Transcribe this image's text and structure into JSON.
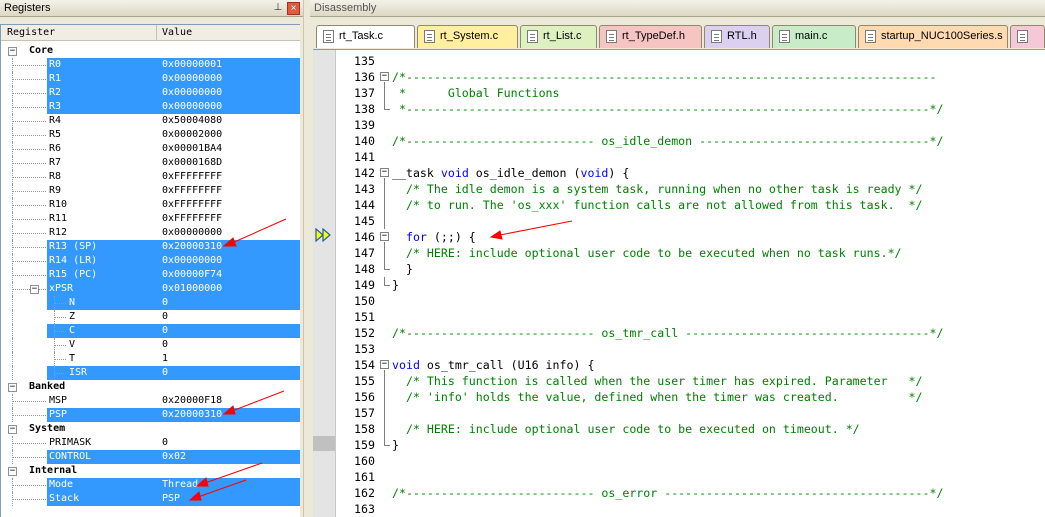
{
  "registers_panel": {
    "title": "Registers",
    "pin_glyph": "⊥",
    "close_glyph": "×",
    "header_register": "Register",
    "header_value": "Value",
    "rows": [
      {
        "name": "Core",
        "value": "",
        "level": 0,
        "group": true,
        "sel": false
      },
      {
        "name": "R0",
        "value": "0x00000001",
        "level": 1,
        "sel": true
      },
      {
        "name": "R1",
        "value": "0x00000000",
        "level": 1,
        "sel": true
      },
      {
        "name": "R2",
        "value": "0x00000000",
        "level": 1,
        "sel": true
      },
      {
        "name": "R3",
        "value": "0x00000000",
        "level": 1,
        "sel": true
      },
      {
        "name": "R4",
        "value": "0x50004080",
        "level": 1,
        "sel": false
      },
      {
        "name": "R5",
        "value": "0x00002000",
        "level": 1,
        "sel": false
      },
      {
        "name": "R6",
        "value": "0x00001BA4",
        "level": 1,
        "sel": false
      },
      {
        "name": "R7",
        "value": "0x0000168D",
        "level": 1,
        "sel": false
      },
      {
        "name": "R8",
        "value": "0xFFFFFFFF",
        "level": 1,
        "sel": false
      },
      {
        "name": "R9",
        "value": "0xFFFFFFFF",
        "level": 1,
        "sel": false
      },
      {
        "name": "R10",
        "value": "0xFFFFFFFF",
        "level": 1,
        "sel": false
      },
      {
        "name": "R11",
        "value": "0xFFFFFFFF",
        "level": 1,
        "sel": false
      },
      {
        "name": "R12",
        "value": "0x00000000",
        "level": 1,
        "sel": false
      },
      {
        "name": "R13 (SP)",
        "value": "0x20000310",
        "level": 1,
        "sel": true
      },
      {
        "name": "R14 (LR)",
        "value": "0x00000000",
        "level": 1,
        "sel": true
      },
      {
        "name": "R15 (PC)",
        "value": "0x00000F74",
        "level": 1,
        "sel": true
      },
      {
        "name": "xPSR",
        "value": "0x01000000",
        "level": 1,
        "sel": true,
        "expandable": true
      },
      {
        "name": "N",
        "value": "0",
        "level": 2,
        "sel": true
      },
      {
        "name": "Z",
        "value": "0",
        "level": 2,
        "sel": false
      },
      {
        "name": "C",
        "value": "0",
        "level": 2,
        "sel": true
      },
      {
        "name": "V",
        "value": "0",
        "level": 2,
        "sel": false
      },
      {
        "name": "T",
        "value": "1",
        "level": 2,
        "sel": false
      },
      {
        "name": "ISR",
        "value": "0",
        "level": 2,
        "sel": true
      },
      {
        "name": "Banked",
        "value": "",
        "level": 0,
        "group": true,
        "sel": false
      },
      {
        "name": "MSP",
        "value": "0x20000F18",
        "level": 1,
        "sel": false
      },
      {
        "name": "PSP",
        "value": "0x20000310",
        "level": 1,
        "sel": true
      },
      {
        "name": "System",
        "value": "",
        "level": 0,
        "group": true,
        "sel": false
      },
      {
        "name": "PRIMASK",
        "value": "0",
        "level": 1,
        "sel": false
      },
      {
        "name": "CONTROL",
        "value": "0x02",
        "level": 1,
        "sel": true
      },
      {
        "name": "Internal",
        "value": "",
        "level": 0,
        "group": true,
        "sel": false
      },
      {
        "name": "Mode",
        "value": "Thread",
        "level": 1,
        "sel": true
      },
      {
        "name": "Stack",
        "value": "PSP",
        "level": 1,
        "sel": true
      }
    ]
  },
  "disassembly_panel": {
    "title": "Disassembly",
    "tabs": [
      {
        "label": "rt_Task.c",
        "color": "#ffffff"
      },
      {
        "label": "rt_System.c",
        "color": "#ffef9e"
      },
      {
        "label": "rt_List.c",
        "color": "#ddf0c0"
      },
      {
        "label": "rt_TypeDef.h",
        "color": "#f7c4c4"
      },
      {
        "label": "RTL.h",
        "color": "#dcd0f0"
      },
      {
        "label": "main.c",
        "color": "#c8ecc8"
      },
      {
        "label": "startup_NUC100Series.s",
        "color": "#ffd9b0"
      },
      {
        "label": "",
        "color": "#f5c8d8"
      }
    ],
    "lines": [
      {
        "n": "135",
        "t": [],
        "fold": ""
      },
      {
        "n": "136",
        "t": [
          [
            "c-com",
            "/*----------------------------------------------------------------------------"
          ]
        ],
        "fold": "open"
      },
      {
        "n": "137",
        "t": [
          [
            "c-com",
            " *      Global Functions"
          ]
        ],
        "fold": "mid"
      },
      {
        "n": "138",
        "t": [
          [
            "c-com",
            " *---------------------------------------------------------------------------*/"
          ]
        ],
        "fold": "end"
      },
      {
        "n": "139",
        "t": [],
        "fold": ""
      },
      {
        "n": "140",
        "t": [
          [
            "c-com",
            "/*--------------------------- os_idle_demon ---------------------------------*/"
          ]
        ],
        "fold": ""
      },
      {
        "n": "141",
        "t": [],
        "fold": ""
      },
      {
        "n": "142",
        "t": [
          [
            "c-txt",
            "__task "
          ],
          [
            "c-kw",
            "void"
          ],
          [
            "c-txt",
            " os_idle_demon ("
          ],
          [
            "c-kw",
            "void"
          ],
          [
            "c-txt",
            ") {"
          ]
        ],
        "fold": "open"
      },
      {
        "n": "143",
        "t": [
          [
            "c-com",
            "  /* The idle demon is a system task, running when no other task is ready */"
          ]
        ],
        "fold": "mid"
      },
      {
        "n": "144",
        "t": [
          [
            "c-com",
            "  /* to run. The 'os_xxx' function calls are not allowed from this task.  */"
          ]
        ],
        "fold": "mid"
      },
      {
        "n": "145",
        "t": [],
        "fold": "mid"
      },
      {
        "n": "146",
        "t": [
          [
            "c-txt",
            "  "
          ],
          [
            "c-kw",
            "for"
          ],
          [
            "c-txt",
            " (;;) {"
          ]
        ],
        "fold": "open2"
      },
      {
        "n": "147",
        "t": [
          [
            "c-com",
            "  /* HERE: include optional user code to be executed when no task runs.*/"
          ]
        ],
        "fold": "mid2"
      },
      {
        "n": "148",
        "t": [
          [
            "c-txt",
            "  }"
          ]
        ],
        "fold": "end2"
      },
      {
        "n": "149",
        "t": [
          [
            "c-txt",
            "}"
          ]
        ],
        "fold": "end"
      },
      {
        "n": "150",
        "t": [],
        "fold": ""
      },
      {
        "n": "151",
        "t": [],
        "fold": ""
      },
      {
        "n": "152",
        "t": [
          [
            "c-com",
            "/*--------------------------- os_tmr_call -----------------------------------*/"
          ]
        ],
        "fold": ""
      },
      {
        "n": "153",
        "t": [],
        "fold": ""
      },
      {
        "n": "154",
        "t": [
          [
            "c-kw",
            "void"
          ],
          [
            "c-txt",
            " os_tmr_call (U16 info) {"
          ]
        ],
        "fold": "open"
      },
      {
        "n": "155",
        "t": [
          [
            "c-com",
            "  /* This function is called when the user timer has expired. Parameter   */"
          ]
        ],
        "fold": "mid"
      },
      {
        "n": "156",
        "t": [
          [
            "c-com",
            "  /* 'info' holds the value, defined when the timer was created.          */"
          ]
        ],
        "fold": "mid"
      },
      {
        "n": "157",
        "t": [],
        "fold": "mid"
      },
      {
        "n": "158",
        "t": [
          [
            "c-com",
            "  /* HERE: include optional user code to be executed on timeout. */"
          ]
        ],
        "fold": "mid"
      },
      {
        "n": "159",
        "t": [
          [
            "c-txt",
            "}"
          ]
        ],
        "fold": "end"
      },
      {
        "n": "160",
        "t": [],
        "fold": ""
      },
      {
        "n": "161",
        "t": [],
        "fold": ""
      },
      {
        "n": "162",
        "t": [
          [
            "c-com",
            "/*--------------------------- os_error --------------------------------------*/"
          ]
        ],
        "fold": ""
      },
      {
        "n": "163",
        "t": [],
        "fold": ""
      }
    ]
  },
  "colors": {
    "selection": "#3399ff",
    "comment": "#008000",
    "keyword": "#0000ff",
    "annotation_arrow": "#ff0000",
    "pc_marker": "#ffff00"
  },
  "icons": {
    "pc_marker": "current-instruction-arrow-icon",
    "pin": "pin-icon",
    "close": "close-icon",
    "file": "file-icon"
  }
}
